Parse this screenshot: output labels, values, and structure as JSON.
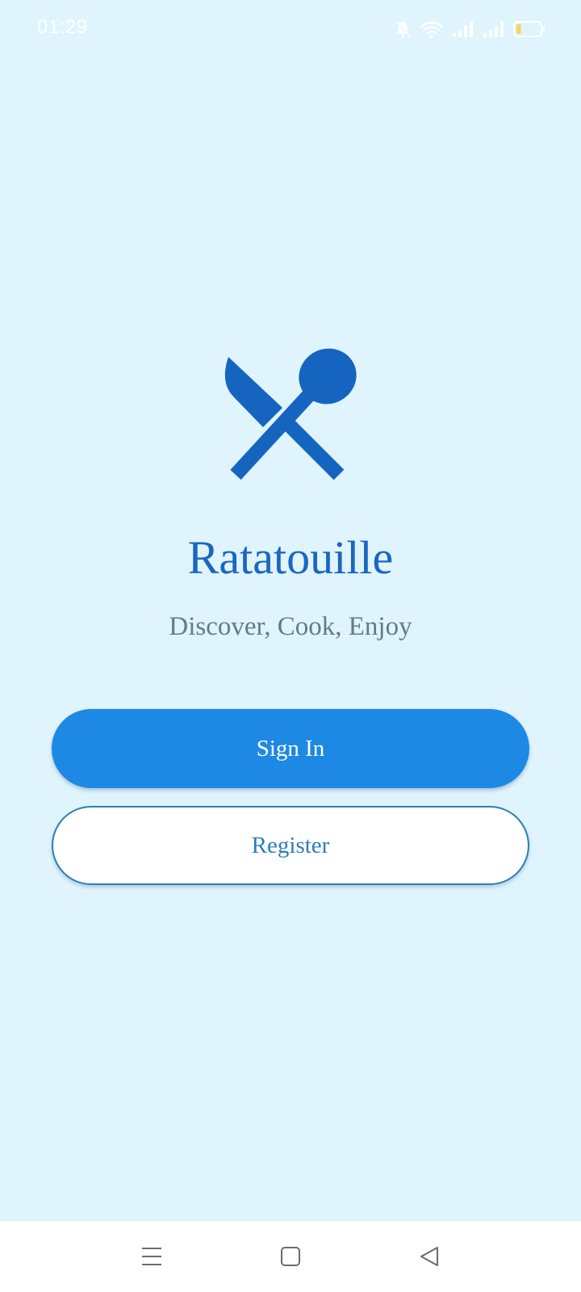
{
  "status_bar": {
    "time": "01:29",
    "icons": [
      "bell-muted-icon",
      "wifi-icon",
      "signal-icon",
      "signal-icon",
      "battery-icon"
    ],
    "battery_level": 0.2
  },
  "app": {
    "logo_icon": "fork-spoon-cross-icon",
    "title": "Ratatouille",
    "tagline": "Discover, Cook, Enjoy"
  },
  "actions": {
    "sign_in_label": "Sign In",
    "register_label": "Register"
  },
  "nav_bar": {
    "icons": [
      "menu-icon",
      "home-square-icon",
      "back-triangle-icon"
    ]
  },
  "colors": {
    "background": "#dff4fd",
    "primary": "#1e88e5",
    "title": "#1a66c2",
    "tagline": "#5f7c8c",
    "register_text": "#2a7fb6"
  }
}
